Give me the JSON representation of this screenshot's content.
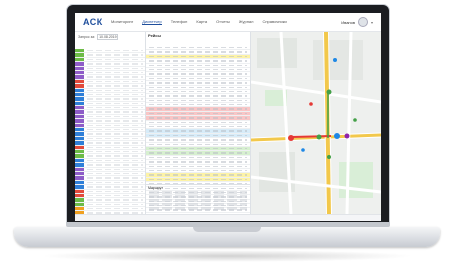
{
  "app": {
    "logo": "АСК"
  },
  "nav": {
    "items": [
      "Мониторинг",
      "Диспетчер",
      "Телефон",
      "Карта",
      "Отчеты",
      "Журнал",
      "Справочники"
    ],
    "active_index": 1
  },
  "user": {
    "name": "Иванов"
  },
  "left_panel": {
    "filter_label": "Запрос за:",
    "date_value": "10.08.2019",
    "row_colors": [
      "#6dbb47",
      "#6dbb47",
      "#6dbb47",
      "#8e5cc8",
      "#8e5cc8",
      "#8e5cc8",
      "#8e5cc8",
      "#e24a3b",
      "#e24a3b",
      "#2f7fd8",
      "#2f7fd8",
      "#2f7fd8",
      "#2f7fd8",
      "#8e5cc8",
      "#8e5cc8",
      "#8e5cc8",
      "#8e5cc8",
      "#8e5cc8",
      "#2f7fd8",
      "#2f7fd8",
      "#2f7fd8",
      "#2f7fd8",
      "#e24a3b",
      "#6dbb47",
      "#6dbb47",
      "#2f7fd8",
      "#2f7fd8",
      "#8e5cc8",
      "#8e5cc8",
      "#8e5cc8",
      "#2f7fd8",
      "#2f7fd8",
      "#e24a3b",
      "#e24a3b",
      "#6dbb47",
      "#6dbb47",
      "#f0a020",
      "#f0a020",
      "#f0a020",
      "#e24a3b",
      "#e24a3b",
      "#e24a3b",
      "#6dbb47",
      "#6dbb47"
    ]
  },
  "mid_panel": {
    "title": "Рейсы",
    "row_highlights": [
      "#ffffff",
      "#ffffff",
      "#fdf3a7",
      "#ffffff",
      "#ffffff",
      "#ffffff",
      "#ffffff",
      "#ffffff",
      "#ffffff",
      "#ffffff",
      "#ffffff",
      "#ffffff",
      "#ffffff",
      "#ffffff",
      "#f9c6c6",
      "#f9c6c6",
      "#f9c6c6",
      "#ffffff",
      "#ffffff",
      "#d7ecf9",
      "#d7ecf9",
      "#ffffff",
      "#ffffff",
      "#d7f0d0",
      "#d7f0d0",
      "#ffffff",
      "#ffffff",
      "#ffffff",
      "#ffffff",
      "#fdf3a7",
      "#fdf3a7",
      "#ffffff",
      "#ffffff",
      "#ffffff",
      "#ffffff",
      "#ffffff",
      "#ffffff",
      "#ffffff",
      "#ffffff",
      "#f9c6c6",
      "#d7f0d0"
    ],
    "sub_title": "Маршрут"
  },
  "map": {
    "road_color": "#f2c84b",
    "route_color": "#e53935",
    "marker_colors": [
      "#e53935",
      "#43a047",
      "#1e88e5",
      "#8e24aa"
    ]
  }
}
